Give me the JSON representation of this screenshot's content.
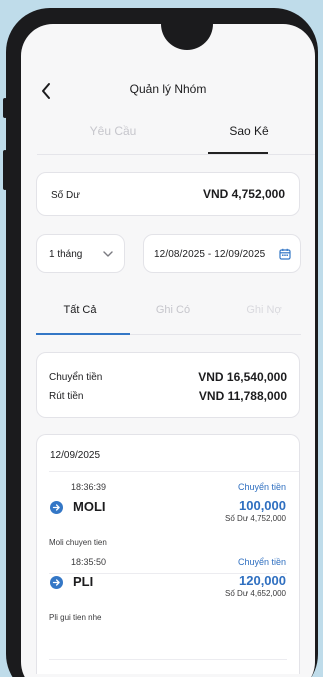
{
  "header": {
    "title": "Quản lý Nhóm"
  },
  "tabs": [
    {
      "label": "Yêu Cầu",
      "active": false
    },
    {
      "label": "Sao Kê",
      "active": true
    }
  ],
  "balance": {
    "label": "Số Dư",
    "value": "VND 4,752,000"
  },
  "filters": {
    "period": "1 tháng",
    "date_range": "12/08/2025 - 12/09/2025"
  },
  "filter_tabs": [
    {
      "label": "Tất Cả",
      "active": true
    },
    {
      "label": "Ghi Có",
      "active": false
    },
    {
      "label": "Ghi Nợ",
      "active": false
    }
  ],
  "summary": {
    "transfer_label": "Chuyển tiền",
    "transfer_value": "VND 16,540,000",
    "withdraw_label": "Rút tiền",
    "withdraw_value": "VND 11,788,000"
  },
  "transactions": {
    "date": "12/09/2025",
    "items": [
      {
        "time": "18:36:39",
        "type": "Chuyển tiền",
        "name": "MOLI",
        "amount": "100,000",
        "balance": "Số Dư 4,752,000",
        "note": "Moli chuyen tien"
      },
      {
        "time": "18:35:50",
        "type": "Chuyển tiền",
        "name": "PLI",
        "amount": "120,000",
        "balance": "Số Dư 4,652,000",
        "note": "Pli gui tien nhe"
      }
    ]
  },
  "colors": {
    "accent": "#2f6fc0",
    "background": "#bfdcea",
    "phone": "#1b1b1d"
  },
  "icons": [
    "back-arrow-icon",
    "chevron-down-icon",
    "calendar-icon",
    "arrow-right-circle-icon"
  ]
}
